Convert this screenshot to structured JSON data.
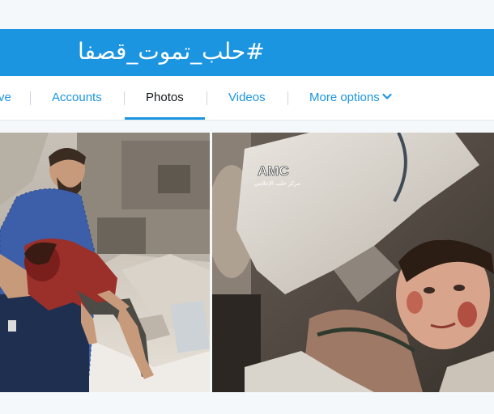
{
  "hashtag": {
    "text": "#حلب_تموت_قصفا"
  },
  "tabs": [
    {
      "label": "ve"
    },
    {
      "label": "Accounts"
    },
    {
      "label": "Photos"
    },
    {
      "label": "Videos"
    },
    {
      "label": "More options"
    }
  ],
  "photos": {
    "left": {
      "subject": "man carrying injured child in rubble"
    },
    "right": {
      "watermark": "AMC",
      "watermark_sub": "مركز حلب الإعلامي",
      "subject": "child trapped under concrete"
    }
  },
  "colors": {
    "accent": "#1b95e0",
    "header_text": "#ffffff",
    "active_tab_text": "#14171a"
  }
}
